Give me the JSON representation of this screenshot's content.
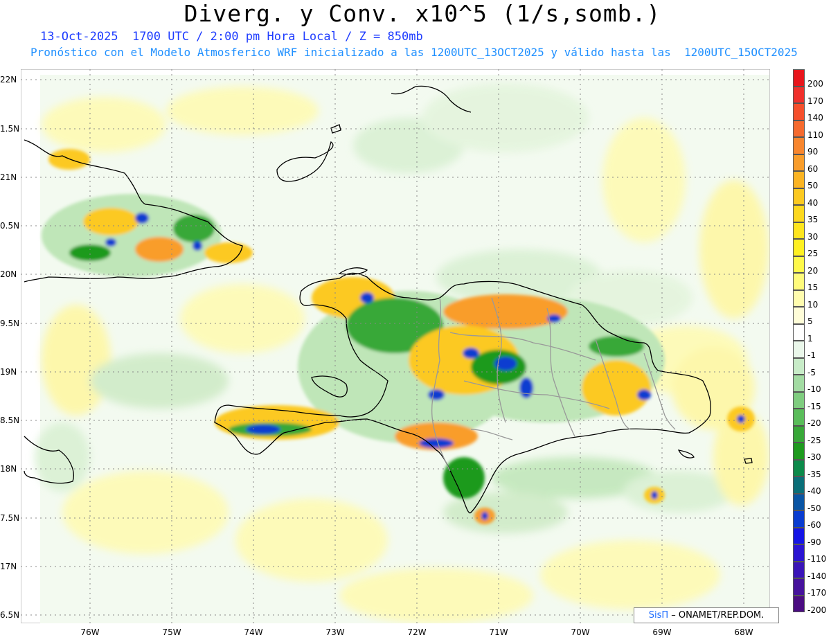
{
  "title": "Diverg. y Conv. x10^5 (1/s,somb.)",
  "subtitle_line1": "13-Oct-2025  1700 UTC / 2:00 pm Hora Local / Z = 850mb",
  "subtitle_line2": "Pronóstico con el Modelo Atmosferico WRF inicializado a las 1200UTC_13OCT2025 y válido hasta las  1200UTC_15OCT2025",
  "lat_labels": [
    "22N",
    "1.5N",
    "21N",
    "0.5N",
    "20N",
    "9.5N",
    "19N",
    "8.5N",
    "18N",
    "7.5N",
    "17N",
    "6.5N"
  ],
  "lon_labels": [
    "76W",
    "75W",
    "74W",
    "73W",
    "72W",
    "71W",
    "70W",
    "69W",
    "68W"
  ],
  "colorbar": {
    "labels": [
      "200",
      "170",
      "140",
      "110",
      "90",
      "60",
      "50",
      "40",
      "35",
      "30",
      "25",
      "20",
      "15",
      "10",
      "5",
      "1",
      "-1",
      "-5",
      "-10",
      "-15",
      "-20",
      "-25",
      "-30",
      "-35",
      "-40",
      "-50",
      "-60",
      "-90",
      "-110",
      "-140",
      "-170",
      "-200"
    ],
    "colors": [
      "#e8151c",
      "#f0302c",
      "#f54f2c",
      "#f66a2e",
      "#f8862e",
      "#f99d2b",
      "#fbb423",
      "#fcc920",
      "#fdd81e",
      "#fee51e",
      "#fff022",
      "#fff94a",
      "#fffb7b",
      "#fffcae",
      "#fffdd8",
      "#ffffff",
      "#eaf7ea",
      "#c8ecc8",
      "#a3dca3",
      "#7fcd7f",
      "#5abd5a",
      "#38a838",
      "#1e9a1e",
      "#0c8a4a",
      "#0a6f78",
      "#0a55a4",
      "#0a3cd0",
      "#1414e6",
      "#2a14d2",
      "#3a14b8",
      "#46129c",
      "#4b0c82"
    ]
  },
  "credit": {
    "brand": "SisΠ",
    "text": "– ONAMET/REP.DOM."
  },
  "colors": {
    "land_border": "#000000",
    "province_border": "#999999",
    "grid": "#888888"
  }
}
